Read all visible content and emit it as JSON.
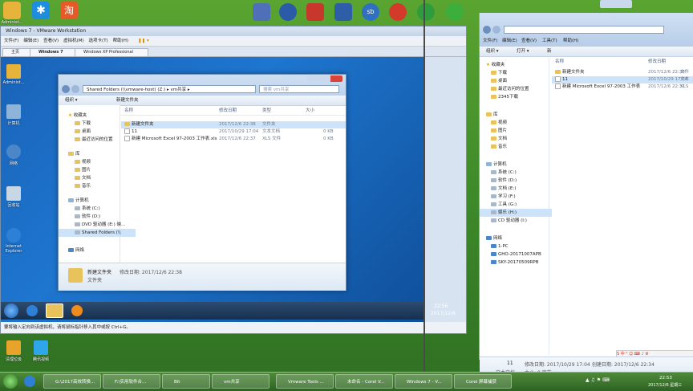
{
  "desktop_top_icons": [
    {
      "label": "Administ...",
      "color": "#e8b33a"
    },
    {
      "label": "",
      "color": "#1d8de0"
    },
    {
      "label": "",
      "color": "#e65a28"
    },
    {
      "label": "",
      "color": "#4f6fb8"
    },
    {
      "label": "",
      "color": "#2a5aa8"
    },
    {
      "label": "",
      "color": "#c8372b"
    },
    {
      "label": "",
      "color": "#2f5ea8"
    },
    {
      "label": "",
      "color": "#3070c0"
    },
    {
      "label": "",
      "color": "#d23a2a"
    },
    {
      "label": "",
      "color": "#2e9c3c"
    },
    {
      "label": "",
      "color": "#3cae3c"
    }
  ],
  "vmware": {
    "title": "Windows 7 - VMware Workstation",
    "menu": [
      "文件(F)",
      "编辑(E)",
      "查看(V)",
      "虚拟机(M)",
      "选项卡(T)",
      "帮助(H)"
    ],
    "tabs": [
      "主页",
      "Windows 7",
      "Windows XP Professional"
    ],
    "status": "要将输入定向到该虚拟机，请将鼠标指针移入其中或按 Ctrl+G。"
  },
  "guest_desktop_icons": [
    "Administ...",
    "计算机",
    "网络",
    "回收站",
    "Internet Explorer"
  ],
  "guest_explorer": {
    "address": "Shared Folders (\\\\vmware-host) (Z:) ▸ vm共享 ▸",
    "search_placeholder": "搜索 vm共享",
    "toolbar": [
      "组织 ▾",
      "新建文件夹"
    ],
    "nav": [
      {
        "label": "收藏夹",
        "group": true
      },
      {
        "label": "下载"
      },
      {
        "label": "桌面"
      },
      {
        "label": "最近访问的位置"
      },
      {
        "label": "库",
        "group": true
      },
      {
        "label": "视频"
      },
      {
        "label": "图片"
      },
      {
        "label": "文档"
      },
      {
        "label": "音乐"
      },
      {
        "label": "计算机",
        "group": true
      },
      {
        "label": "系统 (C:)"
      },
      {
        "label": "软件 (D:)"
      },
      {
        "label": "DVD 驱动器 (E:) 映..."
      },
      {
        "label": "Shared Folders (\\\\"
      },
      {
        "label": "网络",
        "group": true
      }
    ],
    "columns": [
      "名称",
      "修改日期",
      "类型",
      "大小"
    ],
    "rows": [
      {
        "name": "新建文件夹",
        "date": "2017/12/6 22:38",
        "type": "文件夹",
        "size": ""
      },
      {
        "name": "11",
        "date": "2017/10/29 17:04",
        "type": "文本文档",
        "size": "0 KB"
      },
      {
        "name": "新建 Microsoft Excel 97-2003 工作表.xls",
        "date": "2017/12/6 22:37",
        "type": "XLS 文件",
        "size": "0 KB"
      }
    ],
    "detail_name": "新建文件夹",
    "detail_meta": "修改日期: 2017/12/6 22:38",
    "detail_type": "文件夹"
  },
  "guest_clock": {
    "time": "22:56",
    "date": "2017/12/6"
  },
  "right_explorer": {
    "nav": [
      {
        "label": "收藏夹",
        "group": true
      },
      {
        "label": "下载"
      },
      {
        "label": "桌面"
      },
      {
        "label": "最近访问的位置"
      },
      {
        "label": "2345下载"
      },
      {
        "label": "库",
        "group": true
      },
      {
        "label": "视频"
      },
      {
        "label": "图片"
      },
      {
        "label": "文档"
      },
      {
        "label": "音乐"
      },
      {
        "label": "计算机",
        "group": true
      },
      {
        "label": "系统 (C:)"
      },
      {
        "label": "软件 (D:)"
      },
      {
        "label": "文档 (E:)"
      },
      {
        "label": "学习 (F:)"
      },
      {
        "label": "工具 (G:)"
      },
      {
        "label": "娱乐 (H:)"
      },
      {
        "label": "CD 驱动器 (I:)"
      },
      {
        "label": "网络",
        "group": true
      },
      {
        "label": "1-PC"
      },
      {
        "label": "GHO-20171007APB"
      },
      {
        "label": "SKY-20170509RPB"
      }
    ],
    "col_name": "名称",
    "col_date": "修改日期",
    "menu": [
      "文件(F)",
      "编辑(E)",
      "查看(V)",
      "工具(T)",
      "帮助(H)"
    ],
    "toolbar": [
      "组织 ▾",
      "打开 ▾",
      "新"
    ],
    "rows": [
      {
        "name": "新建文件夹",
        "date": "2017/12/6 22:38",
        "extra": "文件"
      },
      {
        "name": "11",
        "date": "2017/10/29 17:04",
        "extra": "文本"
      },
      {
        "name": "新建 Microsoft Excel 97-2003 工作表",
        "date": "2017/12/6 22:37",
        "extra": "XLS"
      }
    ],
    "detail_name": "11",
    "detail_type": "文本文档",
    "detail_modified": "修改日期: 2017/10/29 17:04",
    "detail_created": "创建日期: 2017/12/6 22:34",
    "detail_size": "大小: 0 字节"
  },
  "host_taskbar": {
    "buttons": [
      "G:\\2017高效转换...",
      "F:\\实用软件合...",
      "Bit",
      "vm共享",
      "Vmware Tools ...",
      "未命名 - Corel V...",
      "Windows 7 - V...",
      "Corel 屏幕捕获"
    ],
    "clock_time": "22:53",
    "clock_date": "2017/12/6 星期三"
  },
  "host_desktop_icons": [
    "清理垃圾",
    "腾讯视频"
  ]
}
